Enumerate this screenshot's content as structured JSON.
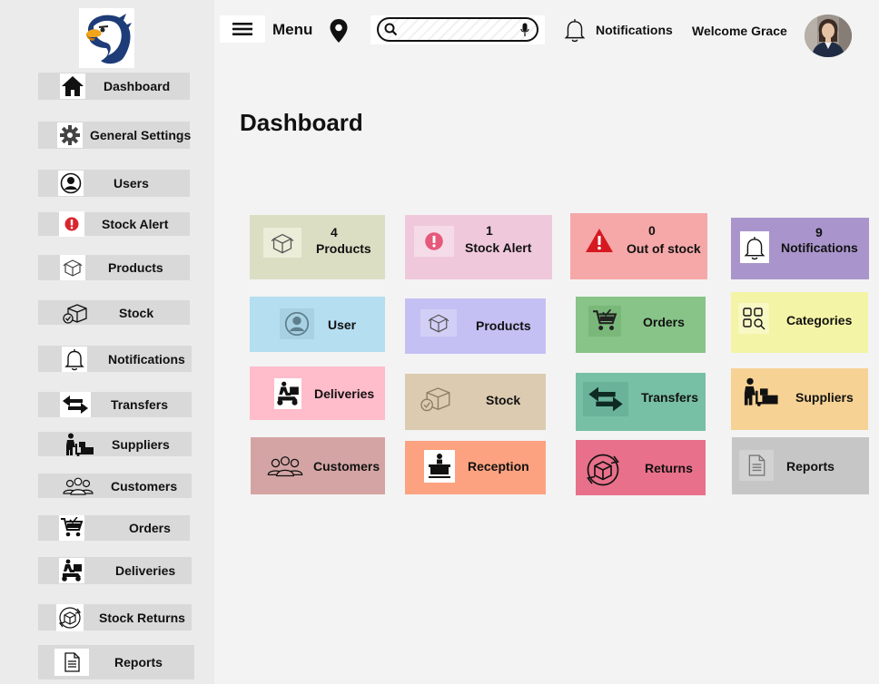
{
  "sidebar": {
    "logo": "eagle-logo",
    "items": [
      {
        "label": "Dashboard",
        "icon": "home-icon"
      },
      {
        "label": "General Settings",
        "icon": "gear-icon"
      },
      {
        "label": "Users",
        "icon": "user-circle-icon"
      },
      {
        "label": "Stock Alert",
        "icon": "alert-icon"
      },
      {
        "label": "Products",
        "icon": "box-icon"
      },
      {
        "label": "Stock",
        "icon": "stock-box-icon"
      },
      {
        "label": "Notifications",
        "icon": "bell-icon"
      },
      {
        "label": "Transfers",
        "icon": "transfer-arrows-icon"
      },
      {
        "label": "Suppliers",
        "icon": "supplier-icon"
      },
      {
        "label": "Customers",
        "icon": "customers-icon"
      },
      {
        "label": "Orders",
        "icon": "cart-icon"
      },
      {
        "label": "Deliveries",
        "icon": "scooter-icon"
      },
      {
        "label": "Stock Returns",
        "icon": "returns-icon"
      },
      {
        "label": "Reports",
        "icon": "report-icon"
      }
    ]
  },
  "header": {
    "menu_label": "Menu",
    "search_placeholder": "",
    "notifications_label": "Notifications",
    "welcome": "Welcome Grace"
  },
  "page": {
    "title": "Dashboard"
  },
  "cards": [
    {
      "count": "4",
      "label": "Products",
      "color": "#dcdec4",
      "icon": "box-icon"
    },
    {
      "count": "1",
      "label": "Stock Alert",
      "color": "#f0c8dc",
      "icon": "alert-icon"
    },
    {
      "count": "0",
      "label": "Out of stock",
      "color": "#f6a8a8",
      "icon": "warning-icon"
    },
    {
      "count": "9",
      "label": "Notifications",
      "color": "#a995cc",
      "icon": "bell-icon"
    },
    {
      "label": "User",
      "color": "#b5def0",
      "icon": "user-circle-icon"
    },
    {
      "label": "Products",
      "color": "#c4c0f4",
      "icon": "box-icon"
    },
    {
      "label": "Orders",
      "color": "#88c388",
      "icon": "cart-icon"
    },
    {
      "label": "Categories",
      "color": "#f4f4a6",
      "icon": "categories-icon"
    },
    {
      "label": "Deliveries",
      "color": "#ffbccb",
      "icon": "scooter-icon"
    },
    {
      "label": "Stock",
      "color": "#dccbb0",
      "icon": "stock-box-icon"
    },
    {
      "label": "Transfers",
      "color": "#77bfa5",
      "icon": "transfer-arrows-icon"
    },
    {
      "label": "Suppliers",
      "color": "#f6d294",
      "icon": "supplier-icon"
    },
    {
      "label": "Customers",
      "color": "#d4a4a4",
      "icon": "customers-icon"
    },
    {
      "label": "Reception",
      "color": "#fda280",
      "icon": "reception-icon"
    },
    {
      "label": "Returns",
      "color": "#e8708a",
      "icon": "returns-icon"
    },
    {
      "label": "Reports",
      "color": "#c6c6c6",
      "icon": "report-icon"
    }
  ]
}
